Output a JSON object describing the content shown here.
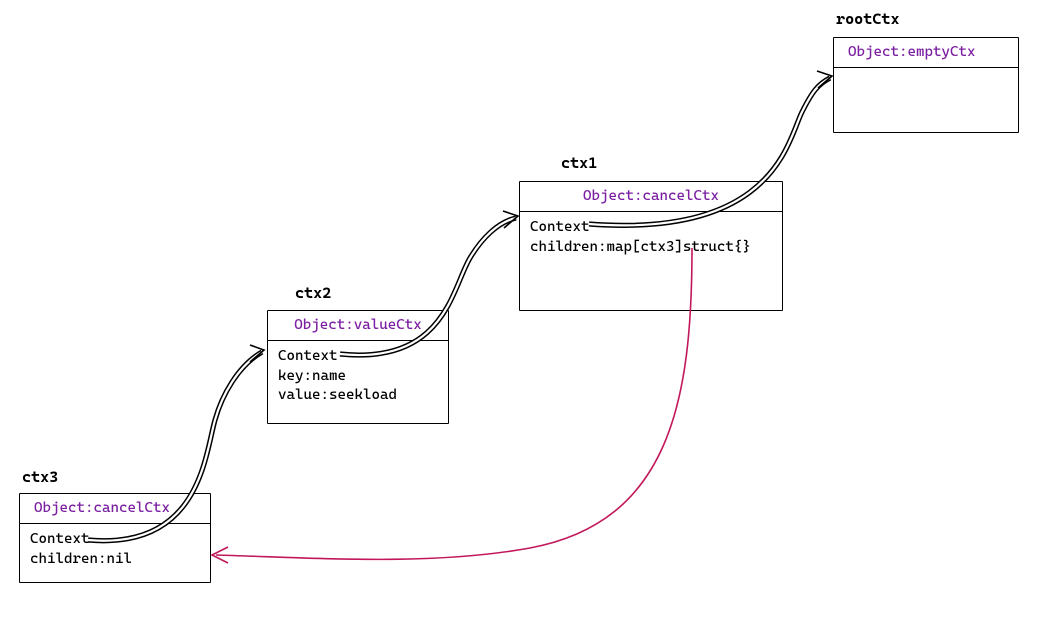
{
  "colors": {
    "objectTitle": "#7b1fa2",
    "pinkArrow": "#c2185b"
  },
  "nodes": {
    "rootCtx": {
      "title": "rootCtx",
      "header": "Object:emptyCtx",
      "body": ""
    },
    "ctx1": {
      "title": "ctx1",
      "header": "Object:cancelCtx",
      "body": "Context\nchildren:map[ctx3]struct{}"
    },
    "ctx2": {
      "title": "ctx2",
      "header": "Object:valueCtx",
      "body": "Context\nkey:name\nvalue:seekload"
    },
    "ctx3": {
      "title": "ctx3",
      "header": "Object:cancelCtx",
      "body": "Context\nchildren:nil"
    }
  },
  "edges": [
    {
      "from": "ctx3.Context",
      "to": "ctx2",
      "style": "double-arrow"
    },
    {
      "from": "ctx2.Context",
      "to": "ctx1",
      "style": "double-arrow"
    },
    {
      "from": "ctx1.Context",
      "to": "rootCtx",
      "style": "double-arrow"
    },
    {
      "from": "ctx1.children[ctx3]",
      "to": "ctx3",
      "style": "pink-arrow"
    }
  ],
  "chart_data": {
    "type": "diagram",
    "description": "Go context chain: ctx3 (cancelCtx) → ctx2 (valueCtx key:name value:seekload) → ctx1 (cancelCtx, children map[ctx3]struct{}) → rootCtx (emptyCtx). ctx1.children references ctx3.",
    "nodes": [
      {
        "id": "rootCtx",
        "type": "emptyCtx"
      },
      {
        "id": "ctx1",
        "type": "cancelCtx",
        "parent": "rootCtx",
        "children": [
          "ctx3"
        ]
      },
      {
        "id": "ctx2",
        "type": "valueCtx",
        "parent": "ctx1",
        "key": "name",
        "value": "seekload"
      },
      {
        "id": "ctx3",
        "type": "cancelCtx",
        "parent": "ctx2",
        "children": null
      }
    ]
  }
}
